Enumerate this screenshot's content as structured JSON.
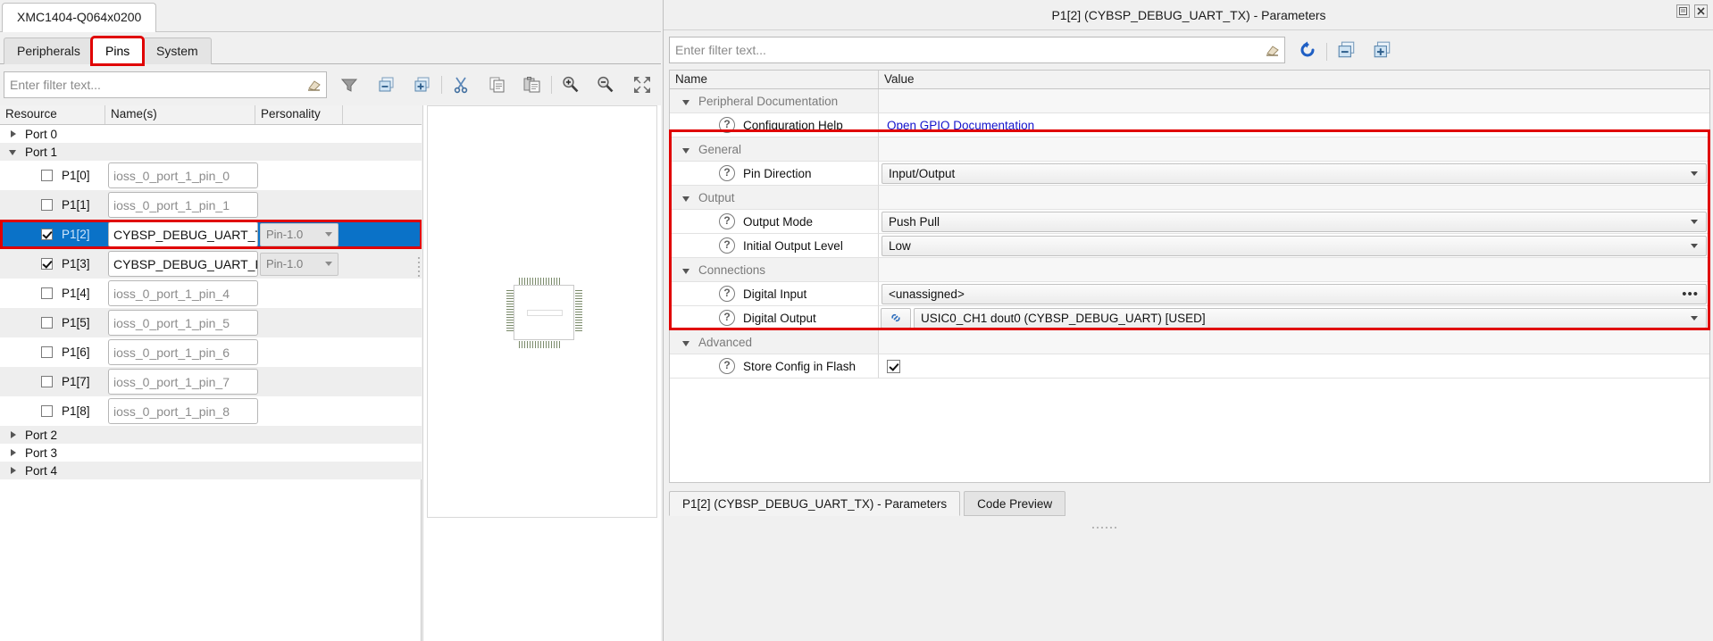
{
  "left": {
    "document_tab": "XMC1404-Q064x0200",
    "view_tabs": [
      {
        "label": "Peripherals",
        "active": false,
        "highlighted": false
      },
      {
        "label": "Pins",
        "active": true,
        "highlighted": true
      },
      {
        "label": "System",
        "active": false,
        "highlighted": false
      }
    ],
    "filter": {
      "placeholder": "Enter filter text...",
      "value": ""
    },
    "toolbar": [
      {
        "name": "filter-icon",
        "title": "Filter"
      },
      {
        "name": "collapse-all-icon",
        "title": "Collapse All"
      },
      {
        "name": "expand-all-icon",
        "title": "Expand All"
      },
      {
        "name": "cut-icon",
        "title": "Cut"
      },
      {
        "name": "copy-icon",
        "title": "Copy"
      },
      {
        "name": "paste-icon",
        "title": "Paste"
      },
      {
        "name": "zoom-in-icon",
        "title": "Zoom In"
      },
      {
        "name": "zoom-out-icon",
        "title": "Zoom Out"
      },
      {
        "name": "fit-to-page-icon",
        "title": "Fit to Page"
      }
    ],
    "table": {
      "columns": [
        "Resource",
        "Name(s)",
        "Personality",
        ""
      ],
      "rows": [
        {
          "type": "group",
          "label": "Port 0",
          "expanded": false
        },
        {
          "type": "group",
          "label": "Port 1",
          "expanded": true
        },
        {
          "type": "pin",
          "id": "P1[0]",
          "name": "ioss_0_port_1_pin_0",
          "name_filled": false,
          "personality": "",
          "checked": false,
          "selected": false
        },
        {
          "type": "pin",
          "id": "P1[1]",
          "name": "ioss_0_port_1_pin_1",
          "name_filled": false,
          "personality": "",
          "checked": false,
          "selected": false
        },
        {
          "type": "pin",
          "id": "P1[2]",
          "name": "CYBSP_DEBUG_UART_TX",
          "name_filled": true,
          "personality": "Pin-1.0",
          "checked": true,
          "selected": true
        },
        {
          "type": "pin",
          "id": "P1[3]",
          "name": "CYBSP_DEBUG_UART_RX",
          "name_filled": true,
          "personality": "Pin-1.0",
          "checked": true,
          "selected": false
        },
        {
          "type": "pin",
          "id": "P1[4]",
          "name": "ioss_0_port_1_pin_4",
          "name_filled": false,
          "personality": "",
          "checked": false,
          "selected": false
        },
        {
          "type": "pin",
          "id": "P1[5]",
          "name": "ioss_0_port_1_pin_5",
          "name_filled": false,
          "personality": "",
          "checked": false,
          "selected": false
        },
        {
          "type": "pin",
          "id": "P1[6]",
          "name": "ioss_0_port_1_pin_6",
          "name_filled": false,
          "personality": "",
          "checked": false,
          "selected": false
        },
        {
          "type": "pin",
          "id": "P1[7]",
          "name": "ioss_0_port_1_pin_7",
          "name_filled": false,
          "personality": "",
          "checked": false,
          "selected": false
        },
        {
          "type": "pin",
          "id": "P1[8]",
          "name": "ioss_0_port_1_pin_8",
          "name_filled": false,
          "personality": "",
          "checked": false,
          "selected": false
        },
        {
          "type": "group",
          "label": "Port 2",
          "expanded": false
        },
        {
          "type": "group",
          "label": "Port 3",
          "expanded": false
        },
        {
          "type": "group",
          "label": "Port 4",
          "expanded": false
        }
      ]
    }
  },
  "right": {
    "title": "P1[2] (CYBSP_DEBUG_UART_TX) - Parameters",
    "window_buttons": [
      {
        "name": "restore-icon",
        "title": "Restore"
      },
      {
        "name": "close-icon",
        "title": "Close"
      }
    ],
    "filter": {
      "placeholder": "Enter filter text...",
      "value": ""
    },
    "toolbar": [
      {
        "name": "refresh-icon",
        "title": "Refresh"
      },
      {
        "name": "collapse-all-icon",
        "title": "Collapse All"
      },
      {
        "name": "expand-all-icon",
        "title": "Expand All"
      }
    ],
    "table": {
      "columns": [
        "Name",
        "Value"
      ],
      "rows": [
        {
          "kind": "section",
          "label": "Peripheral Documentation",
          "expanded": true
        },
        {
          "kind": "param",
          "label": "Configuration Help",
          "control": "link",
          "value": "Open GPIO Documentation"
        },
        {
          "kind": "section",
          "label": "General",
          "expanded": true
        },
        {
          "kind": "param",
          "label": "Pin Direction",
          "control": "combo",
          "value": "Input/Output"
        },
        {
          "kind": "section",
          "label": "Output",
          "expanded": true
        },
        {
          "kind": "param",
          "label": "Output Mode",
          "control": "combo",
          "value": "Push Pull"
        },
        {
          "kind": "param",
          "label": "Initial Output Level",
          "control": "combo",
          "value": "Low"
        },
        {
          "kind": "section",
          "label": "Connections",
          "expanded": true
        },
        {
          "kind": "param",
          "label": "Digital Input",
          "control": "combo-ellipsis",
          "value": "<unassigned>",
          "ellipsis": "•••"
        },
        {
          "kind": "param",
          "label": "Digital Output",
          "control": "combo-chain",
          "value": "USIC0_CH1 dout0 (CYBSP_DEBUG_UART) [USED]"
        },
        {
          "kind": "section",
          "label": "Advanced",
          "expanded": true
        },
        {
          "kind": "param",
          "label": "Store Config in Flash",
          "control": "checkbox",
          "value": "",
          "checked": true
        }
      ]
    },
    "bottom_tabs": [
      {
        "label": "P1[2] (CYBSP_DEBUG_UART_TX) - Parameters",
        "active": true
      },
      {
        "label": "Code Preview",
        "active": false
      }
    ]
  },
  "annotations": {
    "highlight_color": "#e00000",
    "selection_color": "#0a72c8"
  }
}
